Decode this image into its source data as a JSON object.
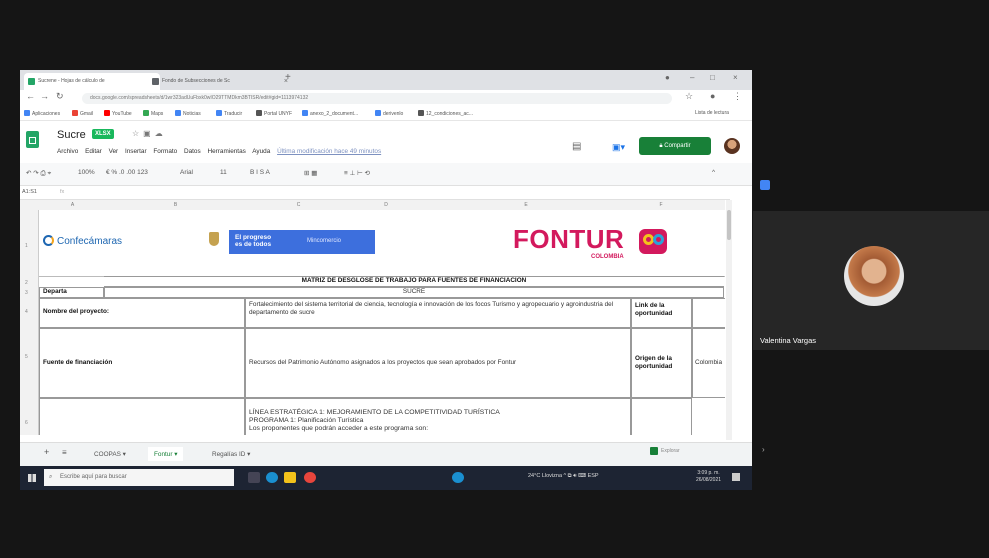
{
  "browser": {
    "tabs": [
      {
        "label": "Sucrene - Hojas de cálculo de",
        "active": true
      },
      {
        "label": "Fondo de Subsecciones de Sc",
        "active": false
      }
    ],
    "address": "docs.google.com/spreadsheets/d/1wr323adUuFbxk0wIO29TTMDkm3BTISR/edit#gid=1113974132",
    "bookmarks": [
      "Aplicaciones",
      "Gmail",
      "YouTube",
      "Maps",
      "Noticias",
      "Traducir",
      "Portal UNYF",
      "anexo_2_document...",
      "derivenlo",
      "12_condiciones_ac..."
    ],
    "reading_list": "Lista de lectura"
  },
  "sheets": {
    "doc_title": "Sucre",
    "badge": "XLSX",
    "menu": [
      "Archivo",
      "Editar",
      "Ver",
      "Insertar",
      "Formato",
      "Datos",
      "Herramientas",
      "Ayuda"
    ],
    "last_edit": "Última modificación hace 49 minutos",
    "share_label": "Compartir",
    "toolbar": {
      "zoom": "100%",
      "format_buttons": "€  %  .0  .00  123",
      "font": "Arial",
      "font_size": "11",
      "text_style": "B  I  S  A",
      "fill_borders": "⊞  ▦",
      "align": "≡  ⊥  ⊢  ⟲"
    },
    "cell_ref": "A1:S1",
    "fx": "fx",
    "columns": [
      "A",
      "B",
      "C",
      "D",
      "E",
      "F"
    ],
    "row_numbers": [
      "1",
      "2",
      "3",
      "4",
      "5",
      "6"
    ],
    "logos": {
      "confecamaras": "Confecámaras",
      "gov_line1": "El progreso",
      "gov_line2": "es de todos",
      "ministry": "Mincomercio",
      "fontur": "FONTUR",
      "colombia": "COLOMBIA"
    },
    "cells": {
      "title": "MATRIZ DE DESGLOSE DE TRABAJO  PARA FUENTES DE FINANCIACIÓN",
      "depart_label": "Departa",
      "depart_value": "SUCRE",
      "project_label": "Nombre del proyecto:",
      "project_value": "Fortalecimiento del sistema territorial de ciencia, tecnología e innovación de los focos Turismo y agropecuario y agroindustria del departamento de sucre",
      "link_label": "Link de la oportunidad",
      "funding_label": "Fuente de financiación",
      "funding_value": "Recursos del Patrimonio Autónomo asignados a los proyectos que sean aprobados por Fontur",
      "origin_label": "Origen de la oportunidad",
      "origin_value": "Colombia",
      "line1": "LÍNEA ESTRATÉGICA 1: MEJORAMIENTO DE LA COMPETITIVIDAD TURÍSTICA",
      "line2": "PROGRAMA 1: Planificación Turística",
      "line3": "Los proponentes que podrán acceder a este programa son:"
    },
    "sheet_tabs": [
      "+",
      "≡",
      "COOPAS",
      "Fontur",
      "Regalías ID"
    ],
    "explore": "Explorar"
  },
  "taskbar": {
    "search_placeholder": "Escribe aquí para buscar",
    "weather": "24°C Llovizna",
    "lang": "ESP",
    "time": "3:09 p. m.",
    "date": "26/08/2021"
  },
  "meeting": {
    "participant_name": "Valentina Vargas"
  },
  "colors": {
    "sheets_green": "#188038",
    "fontur_pink": "#d3195d",
    "gov_blue": "#3d6fdd",
    "taskbar": "#1d2433"
  }
}
